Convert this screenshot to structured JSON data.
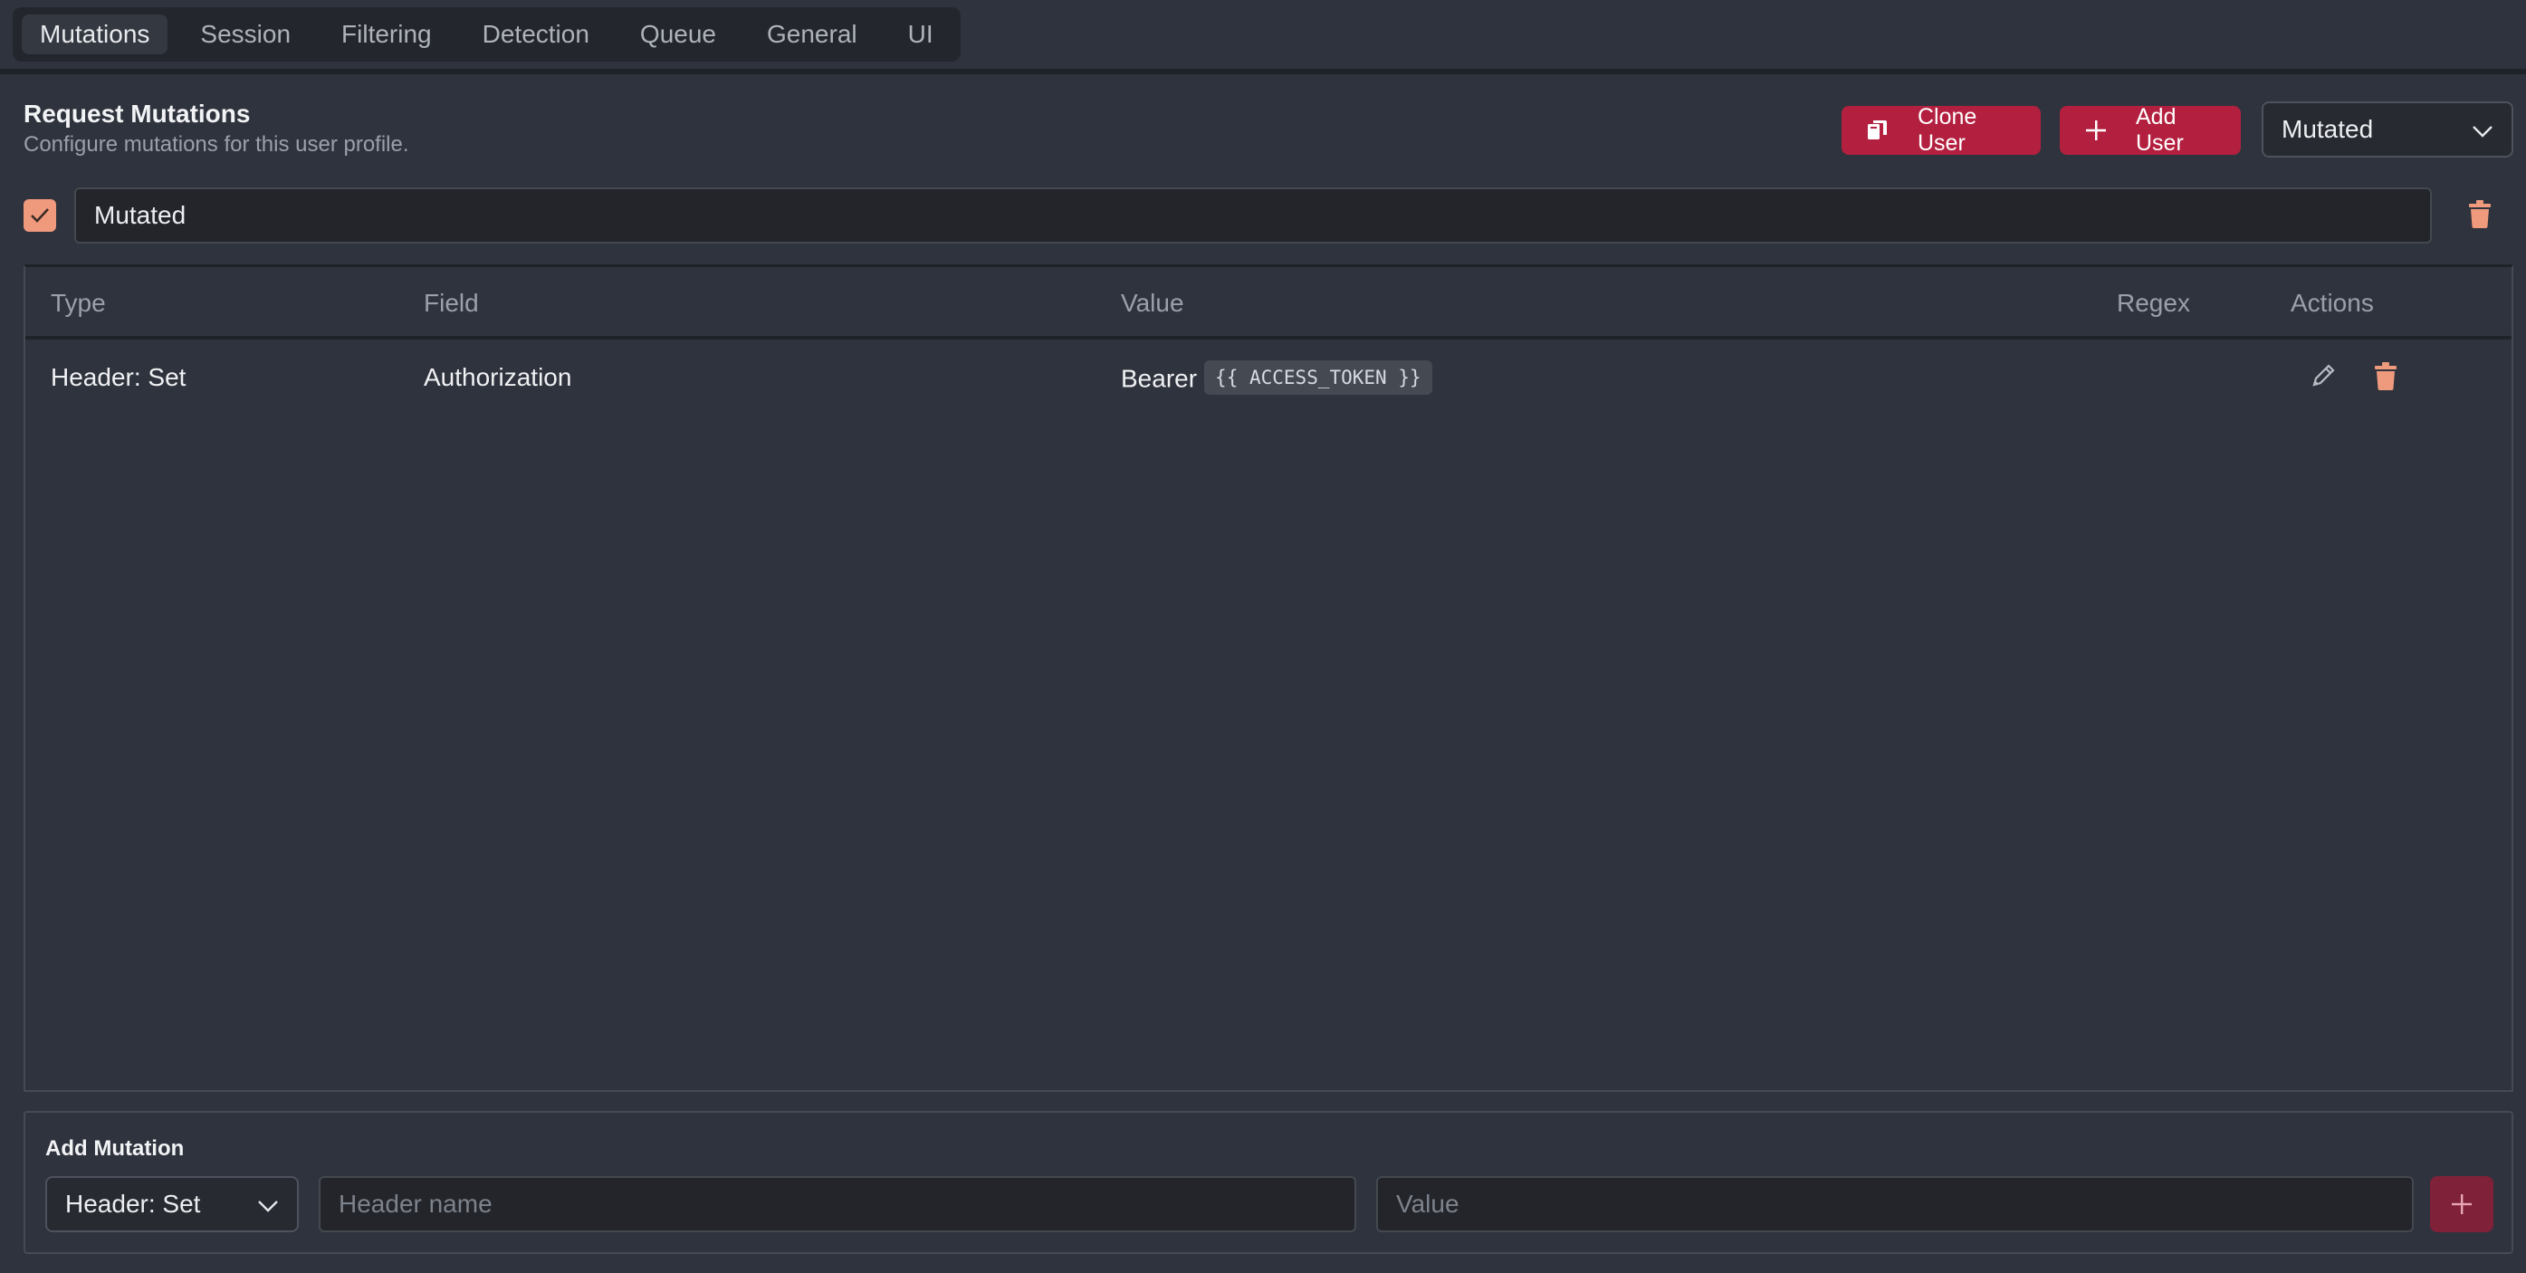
{
  "tabs": [
    "Mutations",
    "Session",
    "Filtering",
    "Detection",
    "Queue",
    "General",
    "UI"
  ],
  "active_tab": "Mutations",
  "section": {
    "title": "Request Mutations",
    "subtitle": "Configure mutations for this user profile."
  },
  "buttons": {
    "clone_user": "Clone User",
    "add_user": "Add User"
  },
  "user_select": {
    "value": "Mutated"
  },
  "profile": {
    "enabled": true,
    "name": "Mutated"
  },
  "table": {
    "headers": {
      "type": "Type",
      "field": "Field",
      "value": "Value",
      "regex": "Regex",
      "actions": "Actions"
    },
    "rows": [
      {
        "type": "Header: Set",
        "field": "Authorization",
        "value_prefix": "Bearer",
        "value_token": "{{ ACCESS_TOKEN }}",
        "regex": ""
      }
    ]
  },
  "add_mutation": {
    "title": "Add Mutation",
    "type_value": "Header: Set",
    "header_placeholder": "Header name",
    "value_placeholder": "Value"
  },
  "colors": {
    "background": "#2f333d",
    "accent_red": "#b3203f",
    "accent_salmon": "#f09a7d",
    "disabled_red": "#7f2139"
  },
  "icons": {
    "clone": "copy-icon",
    "add": "plus-icon",
    "dropdown": "chevron-down-icon",
    "check": "check-icon",
    "delete": "trash-icon",
    "edit": "pencil-icon"
  }
}
